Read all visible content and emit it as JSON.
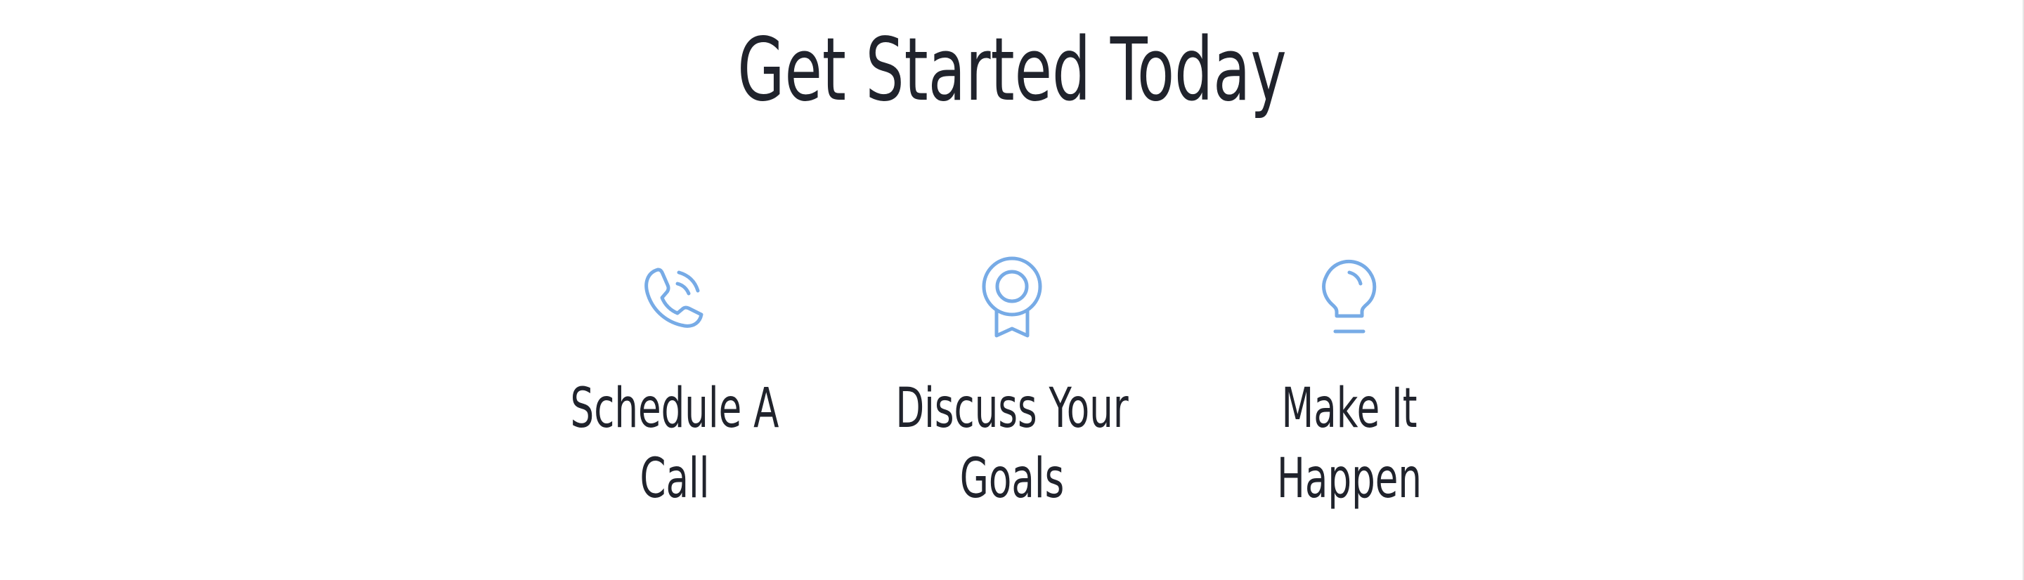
{
  "section": {
    "title": "Get Started Today"
  },
  "colors": {
    "accent": "#77abe6",
    "text": "#20232c",
    "background": "#ffffff"
  },
  "steps": [
    {
      "icon": "phone-icon",
      "line1": "Schedule A",
      "line2": "Call"
    },
    {
      "icon": "award-badge-icon",
      "line1": "Discuss Your",
      "line2": "Goals"
    },
    {
      "icon": "lightbulb-icon",
      "line1": "Make It",
      "line2": "Happen"
    }
  ]
}
